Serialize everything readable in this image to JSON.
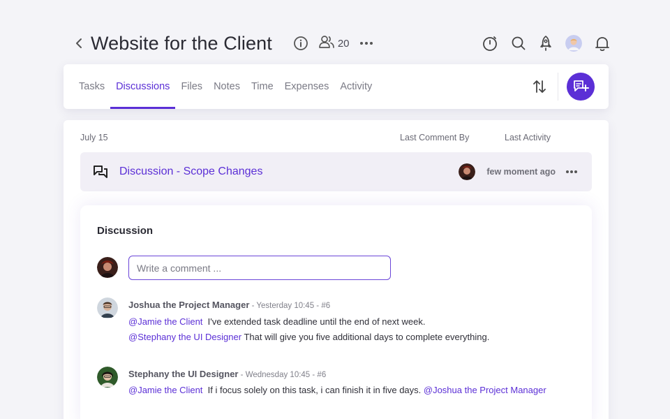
{
  "header": {
    "title": "Website for the Client",
    "member_count": "20",
    "icons": [
      "chevron-left-icon",
      "info-icon",
      "users-icon",
      "more-icon",
      "timer-icon",
      "search-icon",
      "rocket-icon",
      "avatar",
      "bell-icon"
    ]
  },
  "tabs": [
    "Tasks",
    "Discussions",
    "Files",
    "Notes",
    "Time",
    "Expenses",
    "Activity"
  ],
  "active_tab": "Discussions",
  "list": {
    "date": "July 15",
    "col_last_comment_by": "Last Comment By",
    "col_last_activity": "Last Activity",
    "row": {
      "title": "Discussion - Scope Changes",
      "last_activity": "few moment ago"
    }
  },
  "discussion": {
    "heading": "Discussion",
    "comment_placeholder": "Write a comment ...",
    "comments": [
      {
        "author": "Joshua the Project Manager",
        "stamp": " - Yesterday 10:45 - #6",
        "lines": [
          {
            "mention": "@Jamie the Client",
            "text": "  I've extended task deadline until the end of next week."
          },
          {
            "mention": "@Stephany the UI Designer",
            "text": " That will give you five additional days to complete everything."
          }
        ]
      },
      {
        "author": "Stephany the UI Designer",
        "stamp": " - Wednesday 10:45 - #6",
        "lines": [
          {
            "mention": "@Jamie the Client",
            "text": "  If i focus solely on this task, i can finish it in five days. ",
            "trailing_mention": "@Joshua the Project Manager"
          }
        ]
      }
    ]
  },
  "colors": {
    "accent": "#5b2fd6",
    "background": "#f4f4f8",
    "row_bg": "#f1eff6"
  }
}
